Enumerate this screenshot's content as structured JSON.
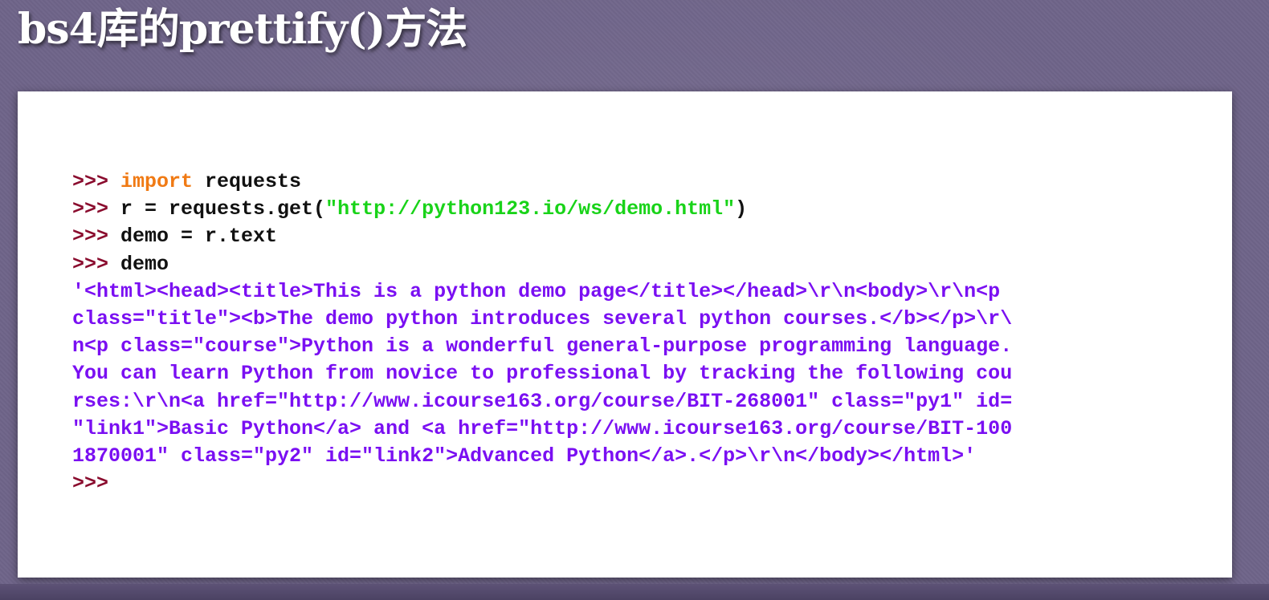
{
  "slide": {
    "title": "bs4库的prettify()方法"
  },
  "code": {
    "lines": [
      {
        "prompt": ">>> ",
        "keyword": "import",
        "text": " requests"
      },
      {
        "prompt": ">>> ",
        "text": "r = requests.get(",
        "string": "\"http://python123.io/ws/demo.html\"",
        "suffix": ")"
      },
      {
        "prompt": ">>> ",
        "text": "demo = r.text"
      },
      {
        "prompt": ">>> ",
        "text": "demo"
      }
    ],
    "output": [
      "'<html><head><title>This is a python demo page</title></head>\\r\\n<body>\\r\\n<p",
      "class=\"title\"><b>The demo python introduces several python courses.</b></p>\\r\\",
      "n<p class=\"course\">Python is a wonderful general-purpose programming language.",
      "You can learn Python from novice to professional by tracking the following cou",
      "rses:\\r\\n<a href=\"http://www.icourse163.org/course/BIT-268001\" class=\"py1\" id=",
      "\"link1\">Basic Python</a> and <a href=\"http://www.icourse163.org/course/BIT-100",
      "1870001\" class=\"py2\" id=\"link2\">Advanced Python</a>.</p>\\r\\n</body></html>'"
    ],
    "final_prompt": ">>>"
  },
  "colors": {
    "background": "#6f6489",
    "prompt": "#8a0c2e",
    "keyword": "#f07a14",
    "string": "#19d319",
    "output": "#7a0ff2"
  }
}
